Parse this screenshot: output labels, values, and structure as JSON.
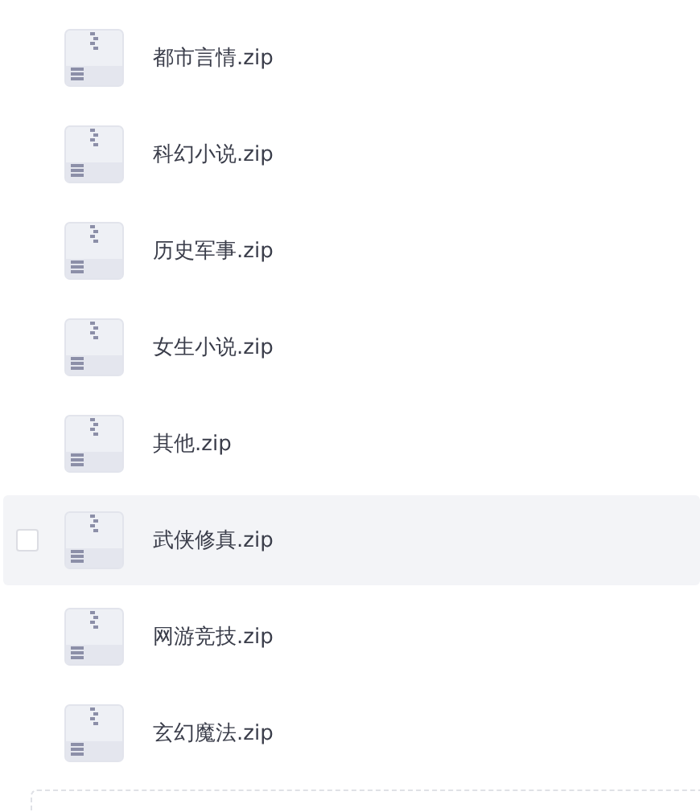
{
  "files": [
    {
      "name": "都市言情.zip",
      "hovered": false,
      "checked": false
    },
    {
      "name": "科幻小说.zip",
      "hovered": false,
      "checked": false
    },
    {
      "name": "历史军事.zip",
      "hovered": false,
      "checked": false
    },
    {
      "name": "女生小说.zip",
      "hovered": false,
      "checked": false
    },
    {
      "name": "其他.zip",
      "hovered": false,
      "checked": false
    },
    {
      "name": "武侠修真.zip",
      "hovered": true,
      "checked": false
    },
    {
      "name": "网游竞技.zip",
      "hovered": false,
      "checked": false
    },
    {
      "name": "玄幻魔法.zip",
      "hovered": false,
      "checked": false
    }
  ]
}
